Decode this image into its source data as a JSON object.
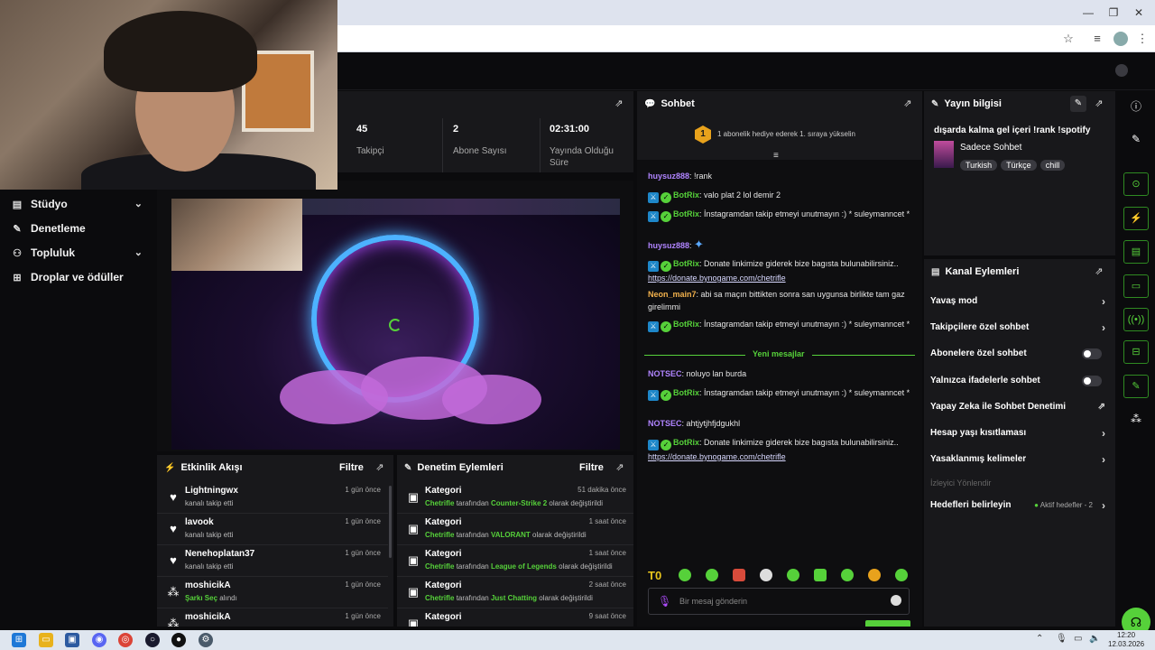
{
  "colors": {
    "accent": "#56d13a",
    "panel": "#18181b",
    "background": "#0b0b0d"
  },
  "sidebar": {
    "items": [
      {
        "label": "Stüdyo",
        "icon": "studio-icon",
        "expandable": true
      },
      {
        "label": "Denetleme",
        "icon": "wrench-icon",
        "expandable": false
      },
      {
        "label": "Topluluk",
        "icon": "community-icon",
        "expandable": true
      },
      {
        "label": "Droplar ve ödüller",
        "icon": "gift-icon",
        "expandable": false
      }
    ]
  },
  "stats": [
    {
      "value": "45",
      "label": "Takipçi"
    },
    {
      "value": "2",
      "label": "Abone Sayısı"
    },
    {
      "value": "02:31:00",
      "label": "Yayında Olduğu Süre"
    }
  ],
  "activity": {
    "title": "Etkinlik Akışı",
    "filter": "Filtre",
    "rows": [
      {
        "icon": "heart-icon",
        "name": "Lightningwx",
        "sub": "kanalı takip etti",
        "time": "1 gün önce"
      },
      {
        "icon": "heart-icon",
        "name": "lavook",
        "sub": "kanalı takip etti",
        "time": "1 gün önce"
      },
      {
        "icon": "heart-icon",
        "name": "Nenehoplatan37",
        "sub": "kanalı takip etti",
        "time": "1 gün önce"
      },
      {
        "icon": "points-icon",
        "name": "moshicikA",
        "sub_green": "Şarkı Seç",
        "sub": "alındı",
        "time": "1 gün önce"
      },
      {
        "icon": "points-icon",
        "name": "moshicikA",
        "sub": "",
        "time": "1 gün önce"
      }
    ]
  },
  "moderation": {
    "title": "Denetim Eylemleri",
    "filter": "Filtre",
    "rows": [
      {
        "name": "Kategori",
        "user": "Chetrifle",
        "mid": "tarafından",
        "value": "Counter-Strike 2",
        "end": "olarak değiştirildi",
        "time": "51 dakika önce"
      },
      {
        "name": "Kategori",
        "user": "Chetrifle",
        "mid": "tarafından",
        "value": "VALORANT",
        "end": "olarak değiştirildi",
        "time": "1 saat önce"
      },
      {
        "name": "Kategori",
        "user": "Chetrifle",
        "mid": "tarafından",
        "value": "League of Legends",
        "end": "olarak değiştirildi",
        "time": "1 saat önce"
      },
      {
        "name": "Kategori",
        "user": "Chetrifle",
        "mid": "tarafından",
        "value": "Just Chatting",
        "end": "olarak değiştirildi",
        "time": "2 saat önce"
      },
      {
        "name": "Kategori",
        "user": "",
        "mid": "",
        "value": "",
        "end": "",
        "time": "9 saat önce"
      }
    ]
  },
  "chat": {
    "title": "Sohbet",
    "gift_rank": "1",
    "gift_text": "1 abonelik hediye ederek 1. sıraya yükselin",
    "new_messages": "Yeni mesajlar",
    "input_placeholder": "Bir mesaj gönderin",
    "messages": [
      {
        "user": "huysuz888",
        "color": "purple",
        "text": "!rank",
        "badges": false
      },
      {
        "user": "BotRix",
        "color": "green",
        "text": "valo plat 2 lol demir 2",
        "badges": true
      },
      {
        "user": "BotRix",
        "color": "green",
        "text": "İnstagramdan takip etmeyi unutmayın :) * suleymanncet *",
        "badges": true
      },
      {
        "user": "huysuz888",
        "color": "purple",
        "text": "",
        "badges": false
      },
      {
        "user": "BotRix",
        "color": "green",
        "text": "Donate linkimize giderek bize bagısta bulunabilirsiniz..",
        "link": "https://donate.bynogame.com/chetrifle",
        "badges": true
      },
      {
        "user": "Neon_main7",
        "color": "orange",
        "text": "abi sa maçın bittikten sonra san uygunsa birlikte tam gaz girelimmi",
        "badges": false
      },
      {
        "user": "BotRix",
        "color": "green",
        "text": "İnstagramdan takip etmeyi unutmayın :) * suleymanncet *",
        "badges": true
      },
      {
        "user": "NOTSEC",
        "color": "purple",
        "text": "noluyo lan burda",
        "badges": false
      },
      {
        "user": "BotRix",
        "color": "green",
        "text": "İnstagramdan takip etmeyi unutmayın :) * suleymanncet *",
        "badges": true
      },
      {
        "user": "NOTSEC",
        "color": "purple",
        "text": "ahtjytjhfjdgukhl",
        "badges": false
      },
      {
        "user": "BotRix",
        "color": "green",
        "text": "Donate linkimize giderek bize bagısta bulunabilirsiniz..",
        "link": "https://donate.bynogame.com/chetrifle",
        "badges": true
      }
    ]
  },
  "stream_info": {
    "title": "Yayın bilgisi",
    "stream_title": "dışarda kalma gel içeri !rank !spotify",
    "category": "Sadece Sohbet",
    "tags": [
      "Turkish",
      "Türkçe",
      "chill"
    ]
  },
  "channel_actions": {
    "title": "Kanal Eylemleri",
    "rows": [
      {
        "label": "Yavaş mod",
        "control": "chevron"
      },
      {
        "label": "Takipçilere özel sohbet",
        "control": "chevron"
      },
      {
        "label": "Abonelere özel sohbet",
        "control": "toggle"
      },
      {
        "label": "Yalnızca ifadelerle sohbet",
        "control": "toggle"
      },
      {
        "label": "Yapay Zeka ile Sohbet Denetimi",
        "control": "external"
      },
      {
        "label": "Hesap yaşı kısıtlaması",
        "control": "chevron"
      },
      {
        "label": "Yasaklanmış kelimeler",
        "control": "chevron"
      }
    ],
    "section_label": "İzleyici Yönlendir",
    "goals_label": "Hedefleri belirleyin",
    "goals_status": "Aktif hedefler - 2"
  },
  "taskbar": {
    "time": "12:20",
    "date": "12.03.2026"
  }
}
